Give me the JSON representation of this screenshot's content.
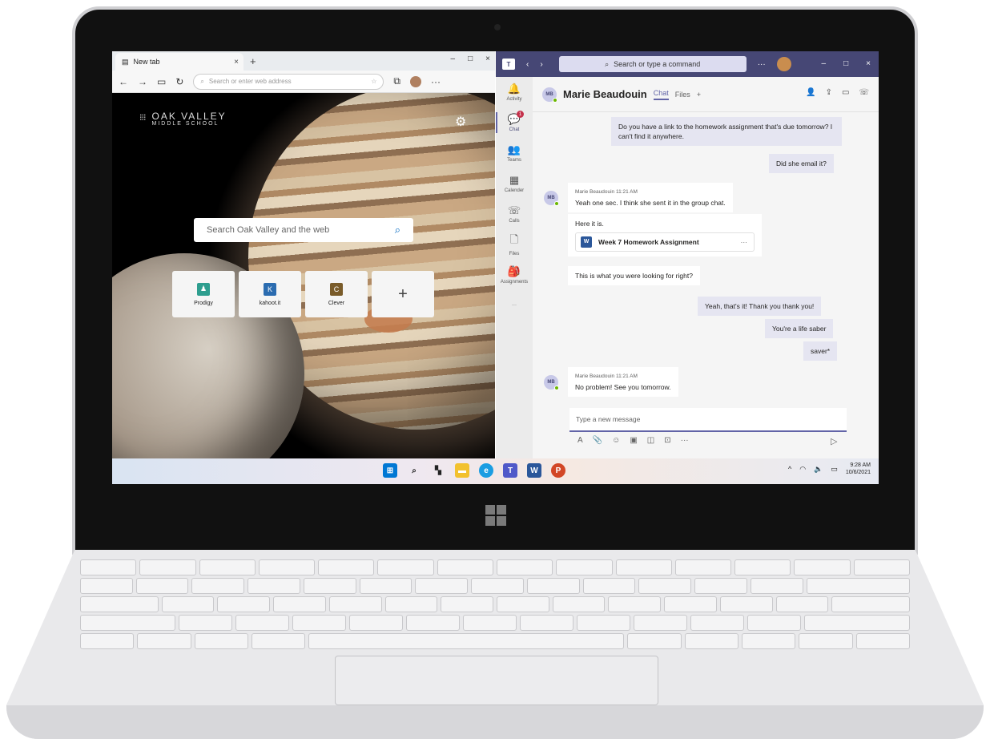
{
  "edge": {
    "tab_title": "New tab",
    "tab_close": "×",
    "new_tab": "+",
    "win_minimize": "–",
    "win_maximize": "□",
    "win_close": "×",
    "nav_back": "←",
    "nav_forward": "→",
    "nav_refresh": "↻",
    "address_placeholder": "Search or enter web address",
    "more": "···",
    "school_name": "OAK VALLEY",
    "school_sub": "MIDDLE SCHOOL",
    "search_placeholder": "Search Oak Valley and the web",
    "tiles": [
      {
        "label": "Prodigy",
        "icon": "prodigy-icon",
        "glyph": "♟",
        "color": "#2e9e8f"
      },
      {
        "label": "kahoot.it",
        "icon": "kahoot-icon",
        "glyph": "K",
        "color": "#2b6cb0"
      },
      {
        "label": "Clever",
        "icon": "clever-icon",
        "glyph": "C",
        "color": "#7a5c2a"
      }
    ],
    "add_tile": "+"
  },
  "teams": {
    "search_placeholder": "Search or type a command",
    "more": "···",
    "win_minimize": "–",
    "win_maximize": "□",
    "win_close": "×",
    "rail": [
      {
        "label": "Activity",
        "icon": "bell-icon",
        "glyph": "🔔"
      },
      {
        "label": "Chat",
        "icon": "chat-icon",
        "glyph": "💬",
        "badge": "1",
        "active": true
      },
      {
        "label": "Teams",
        "icon": "teams-icon",
        "glyph": "👥"
      },
      {
        "label": "Calender",
        "icon": "calendar-icon",
        "glyph": "▦"
      },
      {
        "label": "Calls",
        "icon": "phone-icon",
        "glyph": "☏"
      },
      {
        "label": "Files",
        "icon": "file-icon",
        "glyph": "🗋"
      },
      {
        "label": "Assignments",
        "icon": "assignments-icon",
        "glyph": "🎒"
      }
    ],
    "rail_more": "···",
    "chat": {
      "contact_initials": "MB",
      "contact_name": "Marie Beaudouin",
      "tab_chat": "Chat",
      "tab_files": "Files",
      "tab_add": "+"
    },
    "messages": {
      "m1": "Do you have a link to the homework assignment that's due tomorrow?  I can't find it anywhere.",
      "m2": "Did she email it?",
      "m3_meta": "Marie Beaudouin   11:21 AM",
      "m3": "Yeah one sec. I think she sent it in the group chat.",
      "m4": "Here it is.",
      "file_name": "Week 7 Homework Assignment",
      "file_more": "···",
      "m5": "This is what you were looking for right?",
      "m6": "Yeah, that's it!  Thank you thank you!",
      "m7": "You're a life saber",
      "m8": "saver*",
      "m9_meta": "Marie Beaudouin   11:21 AM",
      "m9": "No problem!  See you tomorrow."
    },
    "compose_placeholder": "Type a new message"
  },
  "taskbar": {
    "time": "9:28 AM",
    "date": "10/6/2021",
    "tray_chevron": "^"
  }
}
